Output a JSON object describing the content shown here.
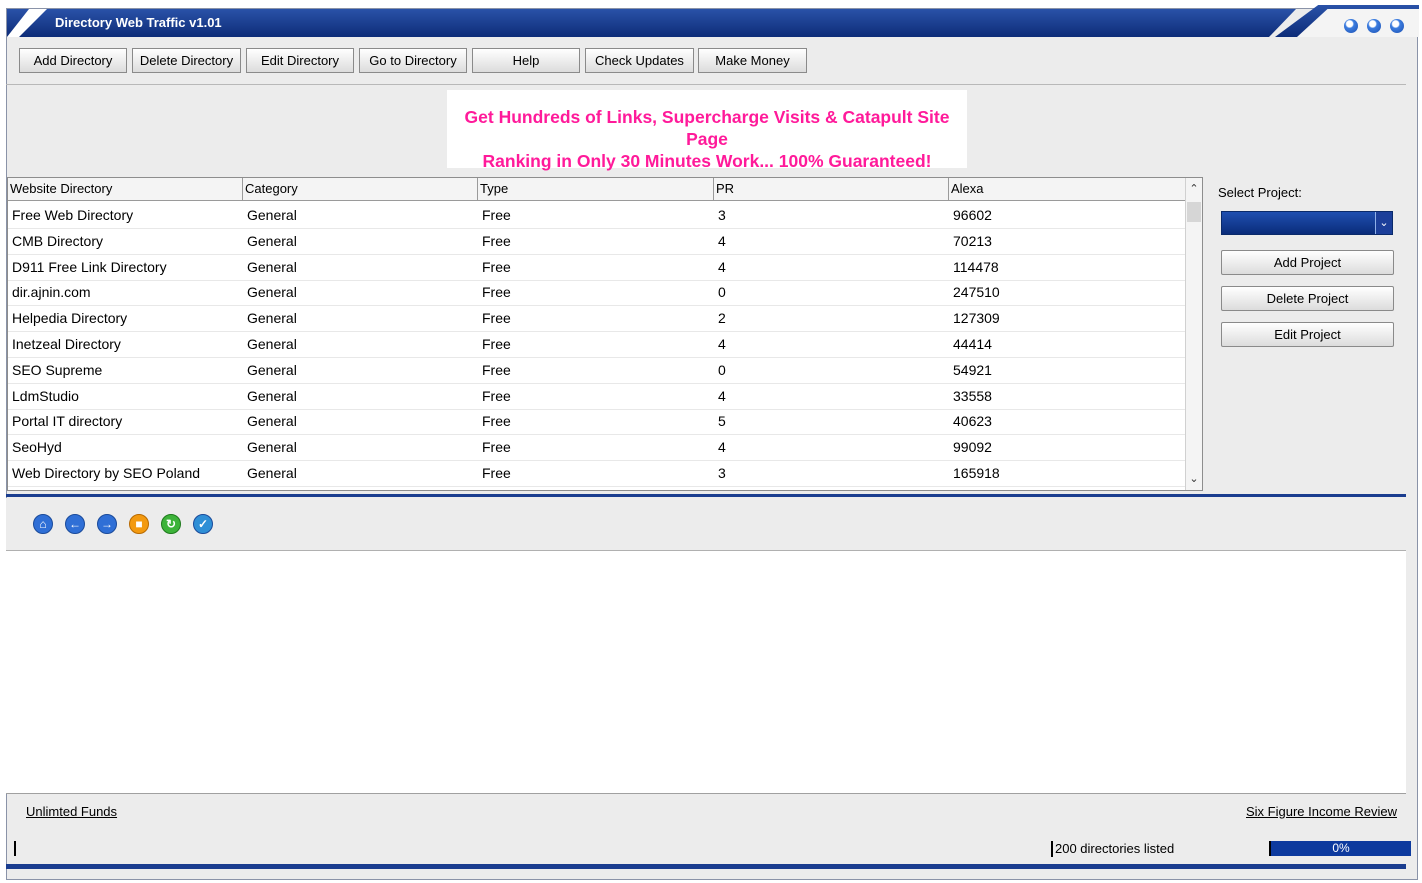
{
  "window": {
    "title": "Directory Web Traffic v1.01"
  },
  "toolbar": {
    "buttons": [
      {
        "label": "Add Directory"
      },
      {
        "label": "Delete Directory"
      },
      {
        "label": "Edit Directory"
      },
      {
        "label": "Go to Directory"
      },
      {
        "label": "Help"
      },
      {
        "label": "Check Updates"
      },
      {
        "label": "Make Money"
      }
    ]
  },
  "banner": {
    "line1": "Get Hundreds of Links, Supercharge Visits & Catapult Site Page",
    "line2": "Ranking in Only 30 Minutes Work... 100% Guaranteed!",
    "color": "#ff1a9a"
  },
  "table": {
    "columns": [
      "Website Directory",
      "Category",
      "Type",
      "PR",
      "Alexa"
    ],
    "rows": [
      [
        "Free Web Directory",
        "General",
        "Free",
        "3",
        "96602"
      ],
      [
        "CMB Directory",
        "General",
        "Free",
        "4",
        "70213"
      ],
      [
        "D911 Free Link Directory",
        "General",
        "Free",
        "4",
        "114478"
      ],
      [
        "dir.ajnin.com",
        "General",
        "Free",
        "0",
        "247510"
      ],
      [
        "Helpedia Directory",
        "General",
        "Free",
        "2",
        "127309"
      ],
      [
        "Inetzeal Directory",
        "General",
        "Free",
        "4",
        "44414"
      ],
      [
        "SEO Supreme",
        "General",
        "Free",
        "0",
        "54921"
      ],
      [
        "LdmStudio",
        "General",
        "Free",
        "4",
        "33558"
      ],
      [
        "Portal IT directory",
        "General",
        "Free",
        "5",
        "40623"
      ],
      [
        "SeoHyd",
        "General",
        "Free",
        "4",
        "99092"
      ],
      [
        "Web Directory by SEO Poland",
        "General",
        "Free",
        "3",
        "165918"
      ]
    ]
  },
  "project_panel": {
    "label": "Select Project:",
    "selected": "",
    "add_label": "Add Project",
    "delete_label": "Delete Project",
    "edit_label": "Edit Project"
  },
  "nav_icons": [
    "home-icon",
    "back-icon",
    "forward-icon",
    "stop-icon",
    "refresh-icon",
    "check-icon"
  ],
  "footer": {
    "left_link": "Unlimted Funds",
    "right_link": "Six Figure Income Review"
  },
  "status": {
    "text": "200 directories listed",
    "progress_label": "0%",
    "progress_fraction": 0
  },
  "colors": {
    "title_blue": "#0d2c78",
    "accent_blue": "#1a3d8f"
  }
}
